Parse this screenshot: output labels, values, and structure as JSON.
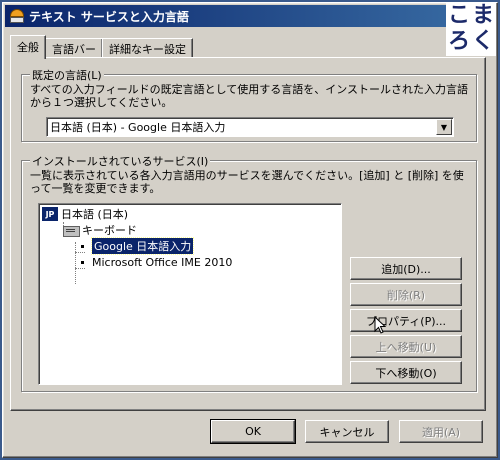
{
  "window": {
    "title": "テキスト サービスと入力言語"
  },
  "brand": {
    "chars": [
      "こ",
      "ま",
      "ろ",
      "く"
    ]
  },
  "tabs": [
    {
      "label": "全般",
      "active": true
    },
    {
      "label": "言語バー",
      "active": false
    },
    {
      "label": "詳細なキー設定",
      "active": false
    }
  ],
  "default_language": {
    "legend": "既定の言語(L)",
    "description": "すべての入力フィールドの既定言語として使用する言語を、インストールされた入力言語から１つ選択してください。",
    "selected": "日本語 (日本) - Google 日本語入力"
  },
  "services": {
    "legend": "インストールされているサービス(I)",
    "description": "一覧に表示されている各入力言語用のサービスを選んでください。[追加] と [削除] を使って一覧を変更できます。",
    "language_badge": "JP",
    "language": "日本語 (日本)",
    "category": "キーボード",
    "items": [
      {
        "label": "Google 日本語入力",
        "selected": true
      },
      {
        "label": "Microsoft Office IME 2010",
        "selected": false
      }
    ]
  },
  "side_buttons": {
    "add": "追加(D)...",
    "remove": "削除(R)",
    "properties": "プロパティ(P)...",
    "move_up": "上へ移動(U)",
    "move_down": "下へ移動(O)"
  },
  "footer_buttons": {
    "ok": "OK",
    "cancel": "キャンセル",
    "apply": "適用(A)"
  },
  "colors": {
    "title_bar": "#0a246a",
    "face": "#d4d0c8",
    "selection": "#0a246a"
  }
}
